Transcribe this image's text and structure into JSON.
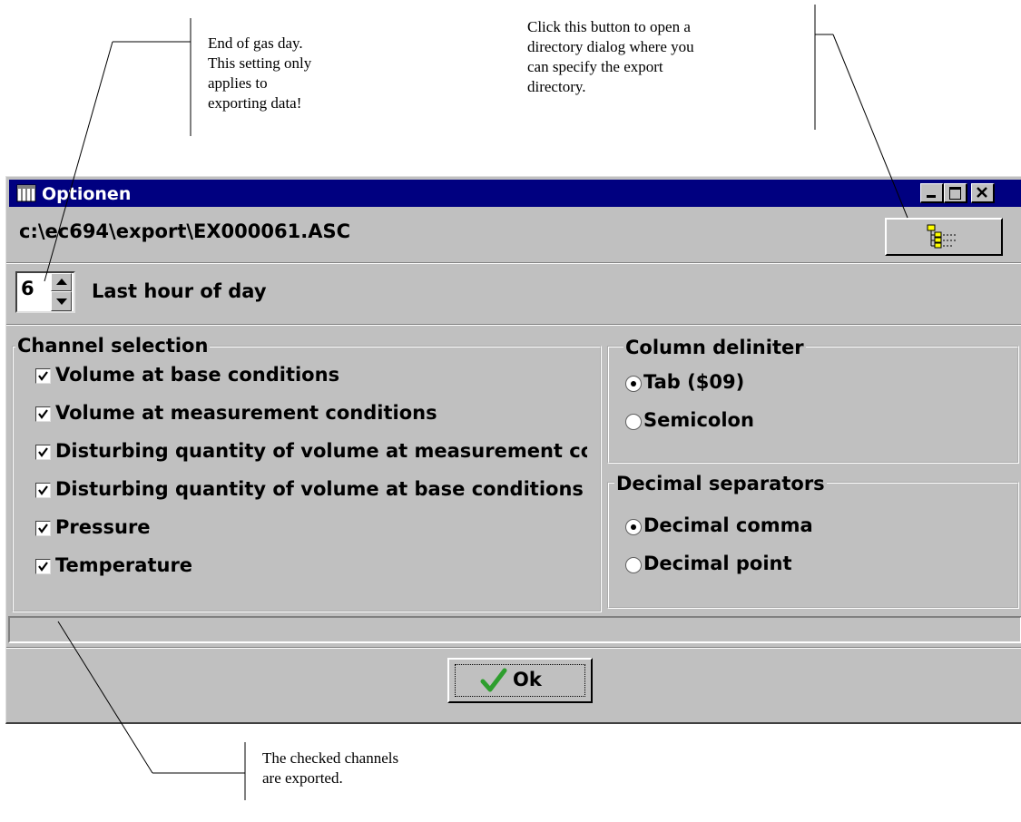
{
  "annotations": {
    "gas_day": "End of gas day.\nThis setting only\napplies to\nexporting data!",
    "dir_button": "Click this button to open a\ndirectory dialog where you\ncan specify the export\ndirectory.",
    "channels": "The checked channels\nare exported."
  },
  "window": {
    "title": "Optionen",
    "icon": "table-app-icon",
    "controls": [
      "minimize-icon",
      "maximize-icon",
      "close-icon"
    ]
  },
  "export": {
    "path": "c:\\ec694\\export\\EX000061.ASC",
    "browse_icon": "directory-tree-icon"
  },
  "hour": {
    "value": "6",
    "label": "Last hour of day"
  },
  "channels": {
    "legend": "Channel selection",
    "items": [
      {
        "label": "Volume at base conditions",
        "checked": true
      },
      {
        "label": "Volume at measurement conditions",
        "checked": true
      },
      {
        "label": "Disturbing quantity of volume at measurement conditions",
        "checked": true
      },
      {
        "label": "Disturbing quantity of volume at base conditions",
        "checked": true
      },
      {
        "label": "Pressure",
        "checked": true
      },
      {
        "label": "Temperature",
        "checked": true
      }
    ]
  },
  "delimiter": {
    "legend": "Column deliniter",
    "options": [
      {
        "label": "Tab ($09)",
        "selected": true
      },
      {
        "label": "Semicolon",
        "selected": false
      }
    ]
  },
  "decimal": {
    "legend": "Decimal separators",
    "options": [
      {
        "label": "Decimal comma",
        "selected": true
      },
      {
        "label": "Decimal point",
        "selected": false
      }
    ]
  },
  "ok_button": {
    "label": "Ok",
    "icon": "checkmark-icon",
    "icon_color": "#2e9e2e"
  },
  "colors": {
    "title_bar": "#000080",
    "face": "#c0c0c0"
  }
}
